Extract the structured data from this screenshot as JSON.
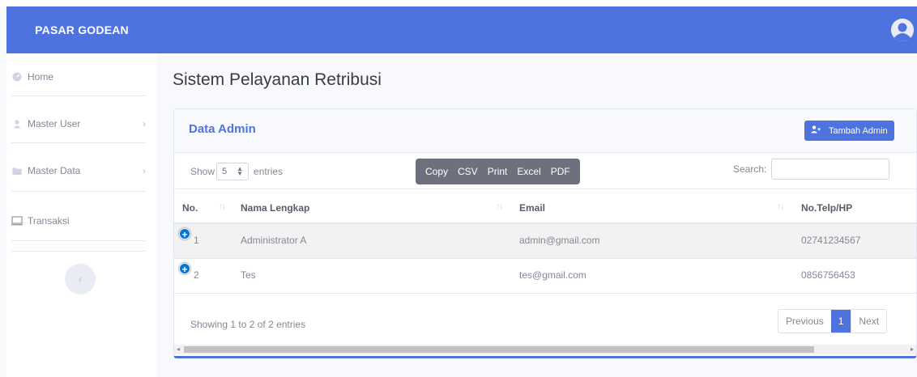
{
  "brand": "PASAR GODEAN",
  "sidebar": {
    "items": [
      {
        "label": "Home",
        "icon": "dashboard-icon"
      },
      {
        "label": "Master User",
        "icon": "user-icon"
      },
      {
        "label": "Master Data",
        "icon": "folder-icon"
      },
      {
        "label": "Transaksi",
        "icon": "monitor-icon"
      }
    ],
    "collapse_icon": "chevron-left-icon"
  },
  "page_title": "Sistem Pelayanan Retribusi",
  "card": {
    "title": "Data Admin",
    "add_button": "Tambah Admin"
  },
  "controls": {
    "show_label": "Show",
    "entries_label": "entries",
    "page_length": "5",
    "buttons": [
      "Copy",
      "CSV",
      "Print",
      "Excel",
      "PDF"
    ],
    "search_label": "Search:",
    "search_value": ""
  },
  "table": {
    "columns": [
      "No.",
      "Nama Lengkap",
      "Email",
      "No.Telp/HP"
    ],
    "rows": [
      {
        "no": "1",
        "nama": "Administrator A",
        "email": "admin@gmail.com",
        "telp": "02741234567"
      },
      {
        "no": "2",
        "nama": "Tes",
        "email": "tes@gmail.com",
        "telp": "0856756453"
      }
    ]
  },
  "footer": {
    "info": "Showing 1 to 2 of 2 entries",
    "prev": "Previous",
    "page": "1",
    "next": "Next"
  },
  "colors": {
    "primary": "#4e73df",
    "sidebar_bg": "#ffffff",
    "page_bg": "#f8f9fc",
    "button_group": "#6e707e"
  }
}
